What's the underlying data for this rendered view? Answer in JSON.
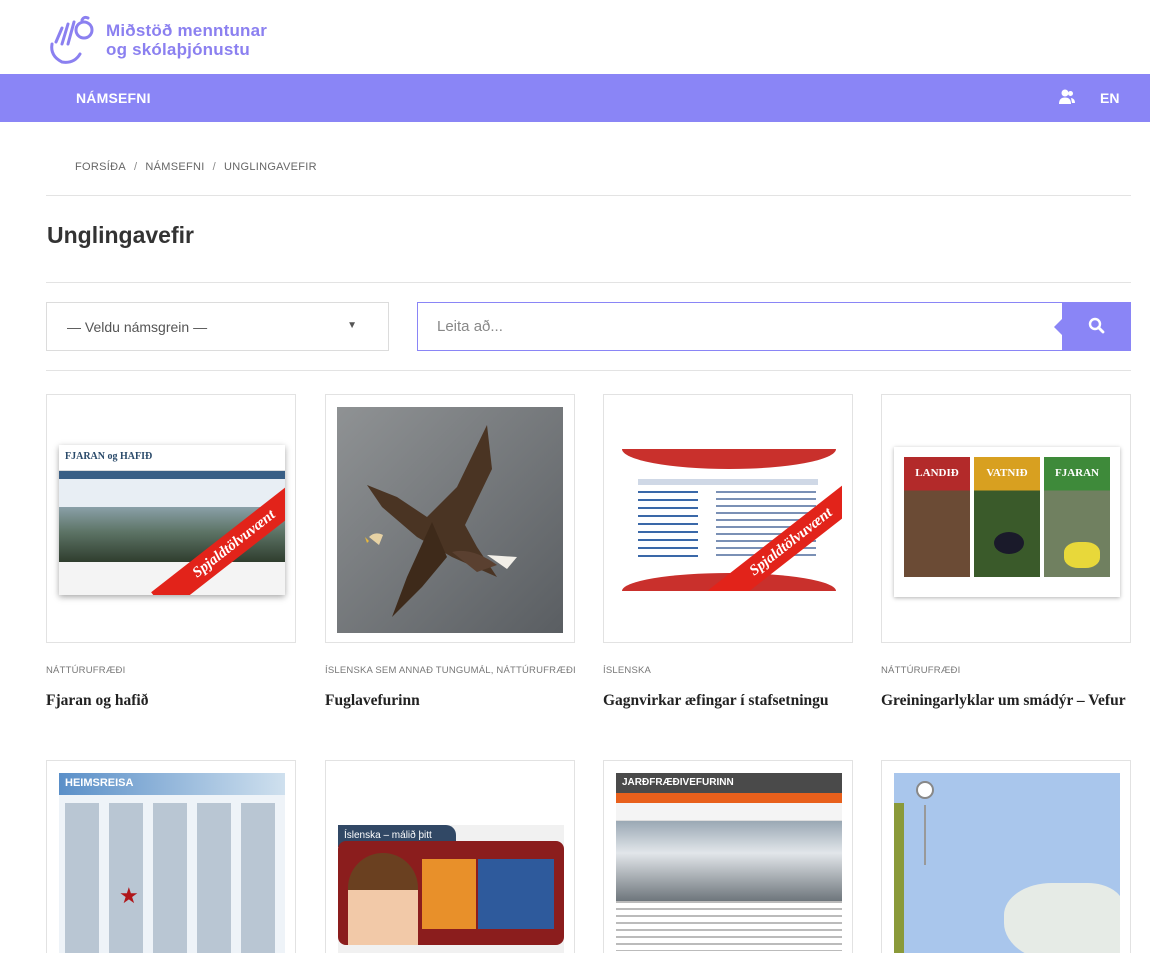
{
  "logo": {
    "line1": "Miðstöð menntunar",
    "line2": "og skólaþjónustu"
  },
  "nav": {
    "item": "NÁMSEFNI",
    "lang": "EN"
  },
  "breadcrumb": [
    "FORSÍÐA",
    "NÁMSEFNI",
    "UNGLINGAVEFIR"
  ],
  "breadcrumb_sep": "/",
  "page_title": "Unglingavefir",
  "filter": {
    "subject_select": "— Veldu námsgrein —",
    "search_placeholder": "Leita að..."
  },
  "cards": [
    {
      "category": "NÁTTÚRUFRÆÐI",
      "title": "Fjaran og hafið",
      "thumb_text": "FJARAN og HAFIÐ",
      "ribbon": "Spjaldtölvuvænt"
    },
    {
      "category": "ÍSLENSKA SEM ANNAÐ TUNGUMÁL, NÁTTÚRUFRÆÐI",
      "title": "Fuglavefurinn"
    },
    {
      "category": "ÍSLENSKA",
      "title": "Gagnvirkar æfingar í stafsetningu",
      "ribbon": "Spjaldtölvuvænt"
    },
    {
      "category": "NÁTTÚRUFRÆÐI",
      "title": "Greiningarlyklar um smádýr – Vefur",
      "panels": [
        "LANDIÐ",
        "VATNIÐ",
        "FJARAN"
      ]
    },
    {
      "category": "",
      "title": "",
      "thumb_text": "HEIMSREISA"
    },
    {
      "category": "",
      "title": "",
      "thumb_text": "Íslenska – málið þitt"
    },
    {
      "category": "",
      "title": "",
      "thumb_text": "JARÐFRÆÐIVEFURINN"
    },
    {
      "category": "",
      "title": ""
    }
  ],
  "colors": {
    "brand": "#8a85f6",
    "ribbon": "#e2231a"
  }
}
